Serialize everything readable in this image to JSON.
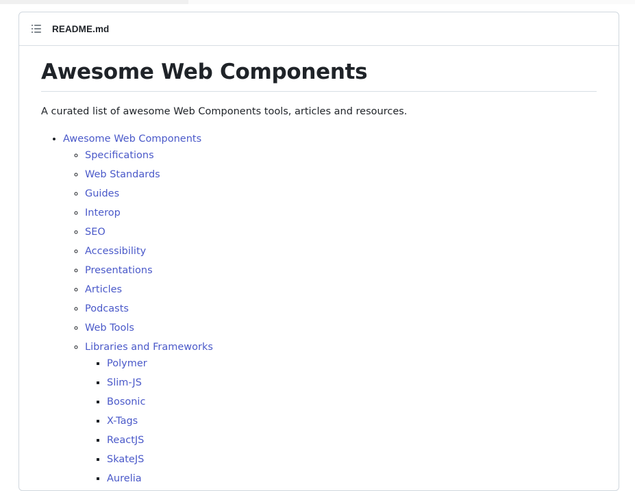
{
  "header": {
    "file_name": "README.md",
    "toc_icon": "list-unordered-icon"
  },
  "readme": {
    "title": "Awesome Web Components",
    "description": "A curated list of awesome Web Components tools, articles and resources.",
    "toc": {
      "root": "Awesome Web Components",
      "sections": [
        "Specifications",
        "Web Standards",
        "Guides",
        "Interop",
        "SEO",
        "Accessibility",
        "Presentations",
        "Articles",
        "Podcasts",
        "Web Tools",
        "Libraries and Frameworks"
      ],
      "libraries": [
        "Polymer",
        "Slim-JS",
        "Bosonic",
        "X-Tags",
        "ReactJS",
        "SkateJS",
        "Aurelia"
      ]
    }
  },
  "colors": {
    "link": "#4a59c9",
    "text": "#1f2328",
    "border": "#d0d7de"
  }
}
